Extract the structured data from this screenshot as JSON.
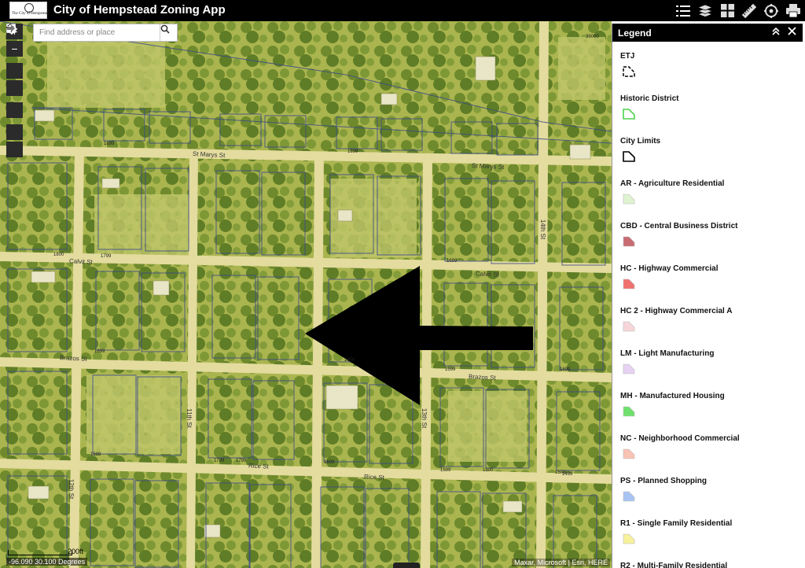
{
  "app": {
    "title": "City of Hempstead Zoning App",
    "logo_text": "The City of Hempstead"
  },
  "toolbar": {
    "icons": [
      "list-icon",
      "layers-icon",
      "basemap-gallery-icon",
      "measure-icon",
      "print-settings-icon",
      "print-icon"
    ]
  },
  "search": {
    "placeholder": "Find address or place"
  },
  "nav": {
    "zoom_in": "+",
    "zoom_out": "−"
  },
  "map": {
    "scale_label": "200ft",
    "coordinates": "-96.090 30.100 Degrees",
    "attribution": "Maxar, Microsoft | Esri, HERE",
    "street_labels": [
      {
        "name": "St Marys St",
        "key": "st_marys_1"
      },
      {
        "name": "St Marys St",
        "key": "st_marys_2"
      },
      {
        "name": "Calvit St",
        "key": "calvit_1"
      },
      {
        "name": "Calvit St",
        "key": "calvit_2"
      },
      {
        "name": "Brazos St",
        "key": "brazos_1"
      },
      {
        "name": "Brazos St",
        "key": "brazos_2"
      },
      {
        "name": "Rice St",
        "key": "rice_1"
      },
      {
        "name": "Rice St",
        "key": "rice_2"
      },
      {
        "name": "11th St",
        "key": "eleventh"
      },
      {
        "name": "12th St",
        "key": "twelfth"
      },
      {
        "name": "13th St",
        "key": "thirteenth"
      },
      {
        "name": "14th St",
        "key": "fourteenth"
      }
    ],
    "lot_numbers": [
      "1899",
      "1899",
      "1800",
      "1799",
      "1699",
      "1699",
      "1699",
      "1600",
      "1599",
      "1599",
      "1499",
      "1799",
      "1799",
      "1699",
      "1599",
      "1500",
      "1500",
      "36000"
    ]
  },
  "legend": {
    "title": "Legend",
    "items": [
      {
        "label": "ETJ",
        "color": "#000000",
        "kind": "etj"
      },
      {
        "label": "Historic District",
        "color": "#4cd44c",
        "kind": "outline"
      },
      {
        "label": "City Limits",
        "color": "#000000",
        "kind": "outline"
      },
      {
        "label": "AR - Agriculture Residential",
        "color": "#dff3d0",
        "kind": "fill"
      },
      {
        "label": "CBD - Central Business District",
        "color": "#c96b72",
        "kind": "fill"
      },
      {
        "label": "HC - Highway Commercial",
        "color": "#ef7270",
        "kind": "fill"
      },
      {
        "label": "HC 2 - Highway Commercial A",
        "color": "#f7d6d9",
        "kind": "fill"
      },
      {
        "label": "LM - Light Manufacturing",
        "color": "#e6d2f2",
        "kind": "fill"
      },
      {
        "label": "MH - Manufactured Housing",
        "color": "#6fe06c",
        "kind": "fill"
      },
      {
        "label": "NC - Neighborhood Commercial",
        "color": "#f8c2b4",
        "kind": "fill"
      },
      {
        "label": "PS - Planned Shopping",
        "color": "#a8c4f2",
        "kind": "fill"
      },
      {
        "label": "R1 - Single Family Residential",
        "color": "#f6f19a",
        "kind": "fill"
      },
      {
        "label": "R2 - Multi-Family Residential",
        "color": "#f4d58a",
        "kind": "fill"
      }
    ]
  }
}
